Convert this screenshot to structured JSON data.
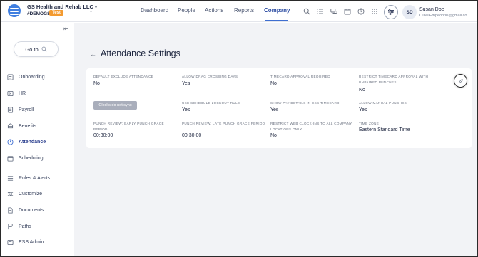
{
  "header": {
    "company_name": "GS Health and Rehab LLC",
    "company_code": "#DEMOGS",
    "env_badge": "Test",
    "nav": [
      "Dashboard",
      "People",
      "Actions",
      "Reports",
      "Company"
    ],
    "active_nav": "Company",
    "icons": [
      "search-icon",
      "list-icon",
      "chat-icon",
      "calendar-icon",
      "help-icon",
      "apps-grid-icon"
    ],
    "user_initials": "SD",
    "user_name": "Susan Doe",
    "user_email": "ODellEmpeon30@gmail.co"
  },
  "sidebar": {
    "goto_label": "Go to",
    "items": [
      {
        "label": "Onboarding",
        "icon": "onboarding-icon"
      },
      {
        "label": "HR",
        "icon": "hr-icon"
      },
      {
        "label": "Payroll",
        "icon": "payroll-icon"
      },
      {
        "label": "Benefits",
        "icon": "benefits-icon"
      },
      {
        "label": "Attendance",
        "icon": "clock-icon",
        "active": true
      },
      {
        "label": "Scheduling",
        "icon": "calendar-icon"
      },
      {
        "label": "Rules & Alerts",
        "icon": "rules-icon"
      },
      {
        "label": "Customize",
        "icon": "sliders-icon"
      },
      {
        "label": "Documents",
        "icon": "document-icon"
      },
      {
        "label": "Paths",
        "icon": "paths-icon"
      },
      {
        "label": "ESS Admin",
        "icon": "ess-admin-icon"
      }
    ]
  },
  "page": {
    "title": "Attendance Settings",
    "sync_button": "Clocks do not sync",
    "settings": [
      {
        "label": "Default Exclude Attendance",
        "value": "No"
      },
      {
        "label": "Allow Drag Crossing Days",
        "value": "Yes"
      },
      {
        "label": "Timecard Approval Required",
        "value": "No"
      },
      {
        "label": "Restrict Timecard Approval With Unpaired Punches",
        "value": "No"
      },
      {
        "label": "Use Schedule Lockout Rule",
        "value": "Yes"
      },
      {
        "label": "Show Pay Details In ESS Timecard",
        "value": "Yes"
      },
      {
        "label": "Allow Manual Punches",
        "value": "Yes"
      },
      {
        "label": "Punch Review: Early Punch Grace Period",
        "value": "00:30:00"
      },
      {
        "label": "Punch Review: Late Punch Grace Period",
        "value": "00:30:00"
      },
      {
        "label": "Restrict Web Clock-Ins To All Company Locations Only",
        "value": "No"
      },
      {
        "label": "Time Zone",
        "value": "Eastern Standard Time"
      }
    ]
  },
  "colors": {
    "accent": "#3f6fd1",
    "test_badge": "#f39a2f",
    "background": "#f2f3f6"
  }
}
